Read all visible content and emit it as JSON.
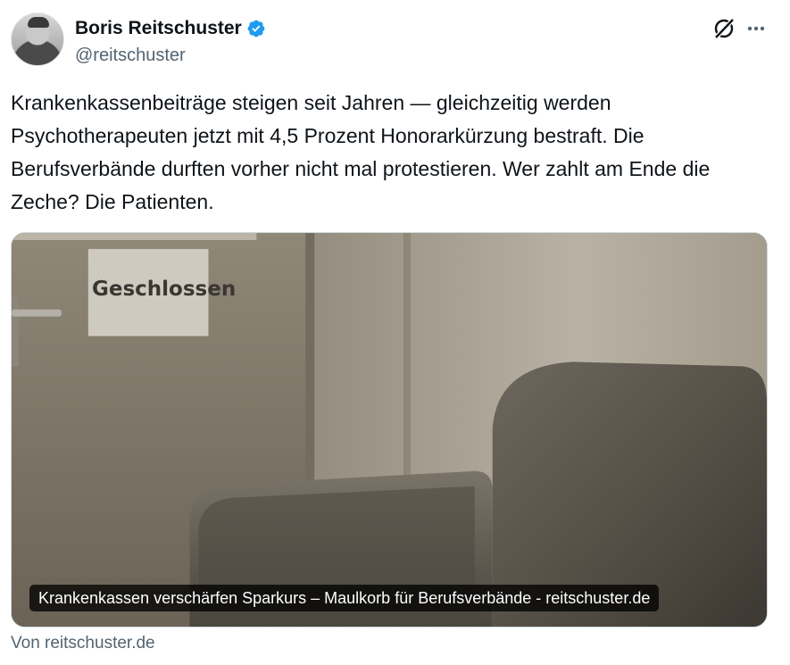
{
  "author": {
    "display_name": "Boris Reitschuster",
    "handle": "@reitschuster",
    "verified_color": "#1d9bf0"
  },
  "actions": {
    "grok_icon": "grok-icon",
    "more_icon": "more-icon"
  },
  "tweet": {
    "text": "Krankenkassenbeiträge steigen seit Jahren — gleichzeitig werden Psychotherapeuten jetzt mit 4,5 Prozent Honorarkürzung bestraft. Die Berufsverbände durften vorher nicht mal protestieren. Wer zahlt am Ende die Zeche? Die Patienten."
  },
  "card": {
    "sign_text": "Geschlossen",
    "caption": "Krankenkassen verschärfen Sparkurs – Maulkorb für Berufsverbände - reitschuster.de",
    "source": "Von reitschuster.de"
  }
}
